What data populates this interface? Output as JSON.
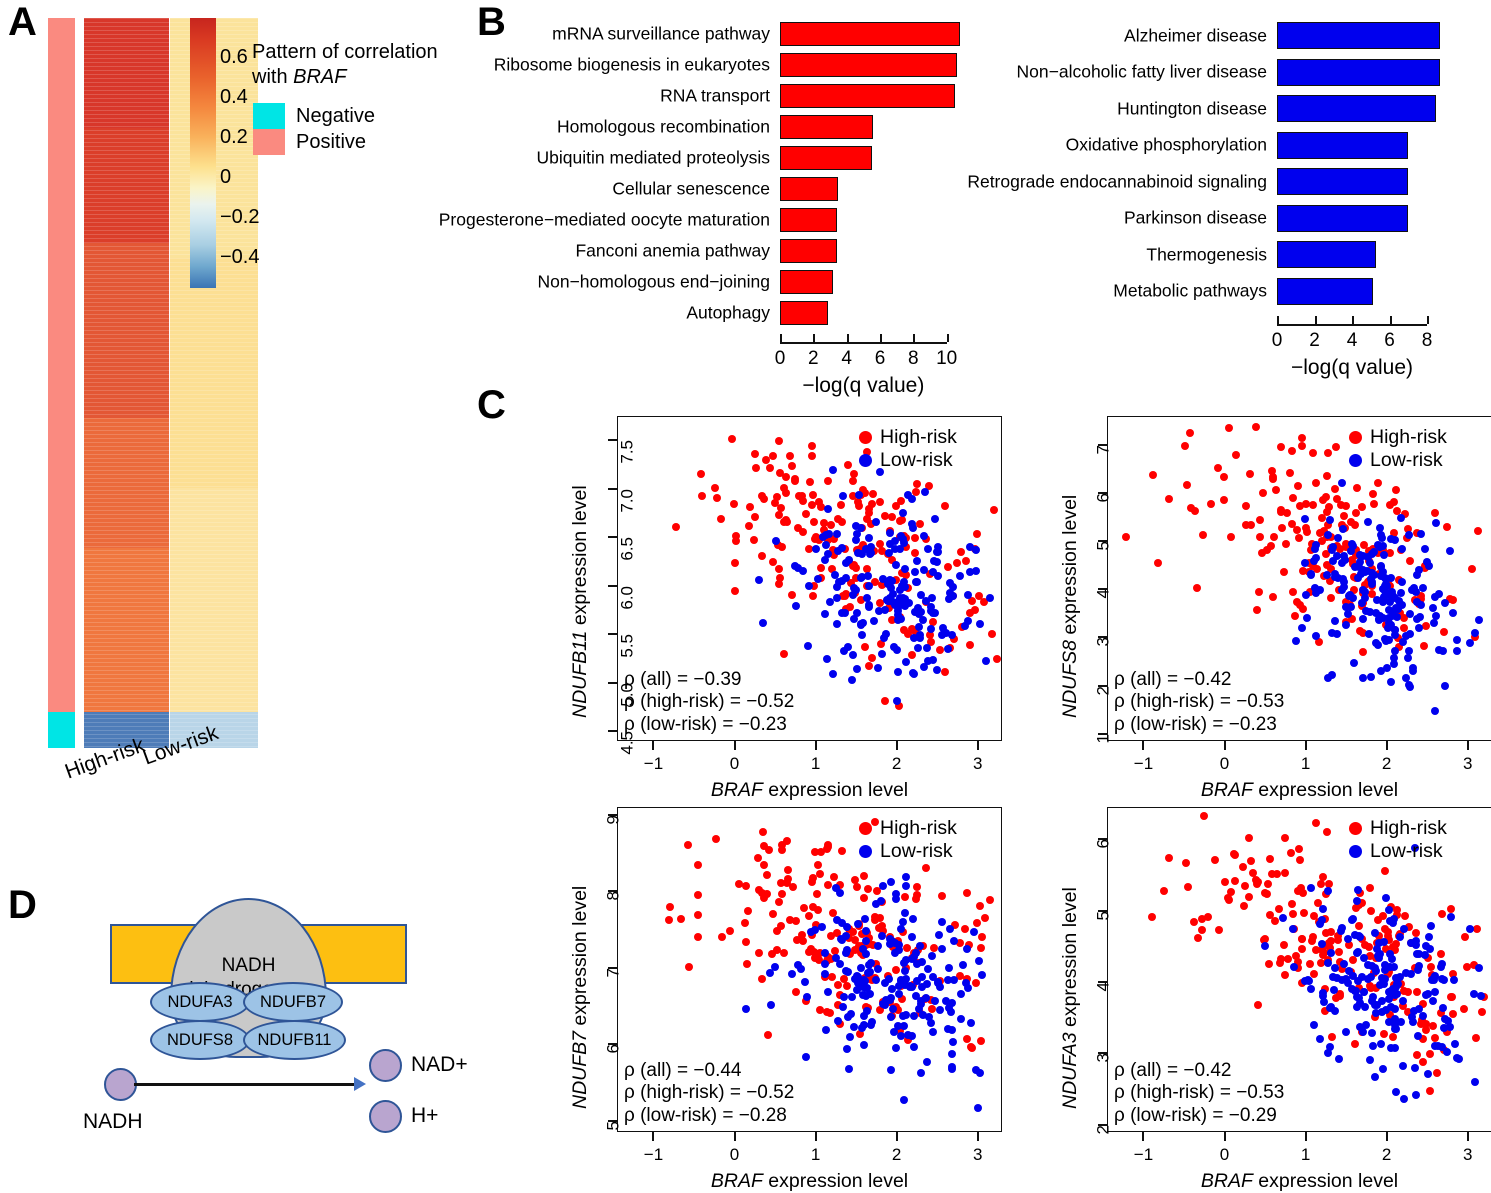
{
  "panels": {
    "a_letter": "A",
    "b_letter": "B",
    "c_letter": "C",
    "d_letter": "D"
  },
  "panelA": {
    "colorbar_ticks": [
      "0.6",
      "0.4",
      "0.2",
      "0",
      "−0.2",
      "−0.4"
    ],
    "legend_title_line1": "Pattern of correlation",
    "legend_title_line2_pre": "with ",
    "legend_title_gene": "BRAF",
    "legend_negative": "Negative",
    "legend_positive": "Positive",
    "group_high": "High-risk",
    "group_low": "Low-risk",
    "colors": {
      "negative": "#00E5E5",
      "positive": "#FA8A80"
    }
  },
  "chart_data": [
    {
      "id": "kegg-red",
      "type": "bar",
      "orientation": "horizontal",
      "title": "",
      "xlabel": "−log(q value)",
      "ylabel": "",
      "xlim": [
        0,
        10.8
      ],
      "xticks": [
        0,
        2,
        4,
        6,
        8,
        10
      ],
      "bar_color": "#FF0000",
      "bar_border": "#111111",
      "categories": [
        "mRNA surveillance pathway",
        "Ribosome biogenesis in eukaryotes",
        "RNA transport",
        "Homologous recombination",
        "Ubiquitin mediated proteolysis",
        "Cellular senescence",
        "Progesterone−mediated oocyte maturation",
        "Fanconi anemia pathway",
        "Non−homologous end−joining",
        "Autophagy"
      ],
      "values": [
        10.8,
        10.6,
        10.5,
        5.6,
        5.5,
        3.5,
        3.4,
        3.4,
        3.2,
        2.9
      ]
    },
    {
      "id": "kegg-blue",
      "type": "bar",
      "orientation": "horizontal",
      "title": "",
      "xlabel": "−log(q value)",
      "ylabel": "",
      "xlim": [
        0,
        8.8
      ],
      "xticks": [
        0,
        2,
        4,
        6,
        8
      ],
      "bar_color": "#0000EE",
      "bar_border": "#111111",
      "categories": [
        "Alzheimer disease",
        "Non−alcoholic fatty liver disease",
        "Huntington disease",
        "Oxidative phosphorylation",
        "Retrograde endocannabinoid signaling",
        "Parkinson disease",
        "Thermogenesis",
        "Metabolic pathways"
      ],
      "values": [
        8.7,
        8.7,
        8.5,
        7.0,
        7.0,
        7.0,
        5.3,
        5.1
      ]
    },
    {
      "id": "scatter-ndufb11",
      "type": "scatter",
      "gene": "NDUFB11",
      "ylabel_gene": "NDUFB11",
      "ylabel_rest": " expression level",
      "xlabel_gene": "BRAF",
      "xlabel_rest": " expression level",
      "xlim": [
        -1.45,
        3.3
      ],
      "ylim": [
        4.4,
        7.75
      ],
      "xticks": [
        -1,
        0,
        1,
        2,
        3
      ],
      "xticklabels": [
        "−1",
        "0",
        "1",
        "2",
        "3"
      ],
      "yticks": [
        4.5,
        5.0,
        5.5,
        6.0,
        6.5,
        7.0,
        7.5
      ],
      "yticklabels": [
        "4.5",
        "5.0",
        "5.5",
        "6.0",
        "6.5",
        "7.0",
        "7.5"
      ],
      "legend": [
        {
          "label": "High-risk",
          "color": "#FF0000"
        },
        {
          "label": "Low-risk",
          "color": "#0000EE"
        }
      ],
      "annotations": [
        "ρ (all) = −0.39",
        "ρ (high-risk) = −0.52",
        "ρ (low-risk) = −0.23"
      ],
      "rho_all": -0.39,
      "rho_high": -0.52,
      "rho_low": -0.23
    },
    {
      "id": "scatter-ndufs8",
      "type": "scatter",
      "gene": "NDUFS8",
      "ylabel_gene": "NDUFS8",
      "ylabel_rest": " expression level",
      "xlabel_gene": "BRAF",
      "xlabel_rest": " expression level",
      "xlim": [
        -1.45,
        3.3
      ],
      "ylim": [
        0.85,
        7.6
      ],
      "xticks": [
        -1,
        0,
        1,
        2,
        3
      ],
      "xticklabels": [
        "−1",
        "0",
        "1",
        "2",
        "3"
      ],
      "yticks": [
        1,
        2,
        3,
        4,
        5,
        6,
        7
      ],
      "yticklabels": [
        "1",
        "2",
        "3",
        "4",
        "5",
        "6",
        "7"
      ],
      "legend": [
        {
          "label": "High-risk",
          "color": "#FF0000"
        },
        {
          "label": "Low-risk",
          "color": "#0000EE"
        }
      ],
      "annotations": [
        "ρ (all) = −0.42",
        "ρ (high-risk) = −0.53",
        "ρ (low-risk) = −0.23"
      ],
      "rho_all": -0.42,
      "rho_high": -0.53,
      "rho_low": -0.23
    },
    {
      "id": "scatter-ndufb7",
      "type": "scatter",
      "gene": "NDUFB7",
      "ylabel_gene": "NDUFB7",
      "ylabel_rest": " expression level",
      "xlabel_gene": "BRAF",
      "xlabel_rest": " expression level",
      "xlim": [
        -1.45,
        3.3
      ],
      "ylim": [
        4.85,
        9.1
      ],
      "xticks": [
        -1,
        0,
        1,
        2,
        3
      ],
      "xticklabels": [
        "−1",
        "0",
        "1",
        "2",
        "3"
      ],
      "yticks": [
        5,
        6,
        7,
        8,
        9
      ],
      "yticklabels": [
        "5",
        "6",
        "7",
        "8",
        "9"
      ],
      "legend": [
        {
          "label": "High-risk",
          "color": "#FF0000"
        },
        {
          "label": "Low-risk",
          "color": "#0000EE"
        }
      ],
      "annotations": [
        "ρ (all) = −0.44",
        "ρ (high-risk) = −0.52",
        "ρ (low-risk) = −0.28"
      ],
      "rho_all": -0.44,
      "rho_high": -0.52,
      "rho_low": -0.28
    },
    {
      "id": "scatter-ndufa3",
      "type": "scatter",
      "gene": "NDUFA3",
      "ylabel_gene": "NDUFA3",
      "ylabel_rest": " expression level",
      "xlabel_gene": "BRAF",
      "xlabel_rest": " expression level",
      "xlim": [
        -1.45,
        3.3
      ],
      "ylim": [
        1.9,
        6.45
      ],
      "xticks": [
        -1,
        0,
        1,
        2,
        3
      ],
      "xticklabels": [
        "−1",
        "0",
        "1",
        "2",
        "3"
      ],
      "yticks": [
        2,
        3,
        4,
        5,
        6
      ],
      "yticklabels": [
        "2",
        "3",
        "4",
        "5",
        "6"
      ],
      "legend": [
        {
          "label": "High-risk",
          "color": "#FF0000"
        },
        {
          "label": "Low-risk",
          "color": "#0000EE"
        }
      ],
      "annotations": [
        "ρ (all) = −0.42",
        "ρ (high-risk) = −0.53",
        "ρ (low-risk) = −0.29"
      ],
      "rho_all": -0.42,
      "rho_high": -0.53,
      "rho_low": -0.29
    }
  ],
  "panelD": {
    "enzyme_line1": "NADH",
    "enzyme_line2": "dehydrogenase",
    "subunits": [
      "NDUFA3",
      "NDUFB7",
      "NDUFS8",
      "NDUFB11"
    ],
    "substrate": "NADH",
    "product1": "NAD+",
    "product2": "H+",
    "colors": {
      "membrane": "#FDBF11",
      "enzyme": "#C9C9C9",
      "subunit": "#9DC3E6",
      "molecule": "#B9A5CF",
      "outline": "#2F5597"
    }
  }
}
